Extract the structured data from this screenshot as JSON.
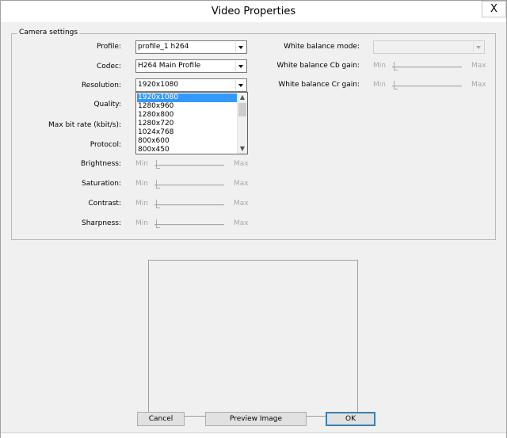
{
  "window": {
    "title": "Video Properties",
    "close_glyph": "X"
  },
  "camera_settings": {
    "legend": "Camera settings",
    "profile": {
      "label": "Profile:",
      "value": "profile_1 h264"
    },
    "codec": {
      "label": "Codec:",
      "value": "H264 Main Profile"
    },
    "resolution": {
      "label": "Resolution:",
      "value": "1920x1080",
      "open": true,
      "options": [
        "1920x1080",
        "1280x960",
        "1280x800",
        "1280x720",
        "1024x768",
        "800x600",
        "800x450"
      ],
      "selected_index": 0
    },
    "quality": {
      "label": "Quality:"
    },
    "max_bit_rate": {
      "label": "Max bit rate (kbit/s):"
    },
    "protocol": {
      "label": "Protocol:"
    },
    "brightness": {
      "label": "Brightness:",
      "min": "Min",
      "max": "Max",
      "level": 0
    },
    "saturation": {
      "label": "Saturation:",
      "min": "Min",
      "max": "Max",
      "level": 0
    },
    "contrast": {
      "label": "Contrast:",
      "min": "Min",
      "max": "Max",
      "level": 0
    },
    "sharpness": {
      "label": "Sharpness:",
      "min": "Min",
      "max": "Max",
      "level": 0
    },
    "white_balance_mode": {
      "label": "White balance mode:",
      "value": "",
      "enabled": false
    },
    "white_balance_cb": {
      "label": "White balance Cb gain:",
      "min": "Min",
      "max": "Max",
      "level": 0
    },
    "white_balance_cr": {
      "label": "White balance Cr gain:",
      "min": "Min",
      "max": "Max",
      "level": 0
    }
  },
  "buttons": {
    "cancel": "Cancel",
    "preview": "Preview Image",
    "ok": "OK"
  },
  "colors": {
    "selection": "#3399ff",
    "window_bg": "#f0f0f0"
  },
  "icons": {
    "close": "close-icon",
    "dropdown": "chevron-down-icon",
    "scroll_up": "scroll-up-icon",
    "scroll_down": "scroll-down-icon"
  }
}
